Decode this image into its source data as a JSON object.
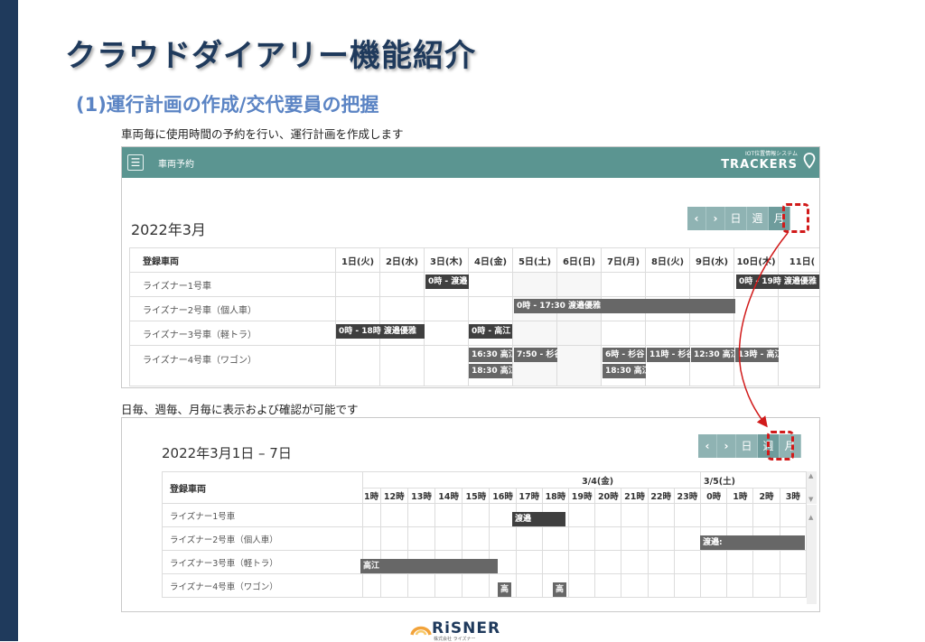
{
  "slide": {
    "title": "クラウドダイアリー機能紹介",
    "subtitle": "(1)運行計画の作成/交代要員の把握",
    "desc1": "車両毎に使用時間の予約を行い、運行計画を作成します",
    "desc2": "日毎、週毎、月毎に表示および確認が可能です",
    "logo_text": "RiSNER",
    "logo_sub": "株式会社 ライズナー"
  },
  "app": {
    "menu_icon": "hamburger-icon",
    "label": "車両予約",
    "brand_small": "IOT位置情報システム",
    "brand_name": "TRACKERS",
    "brand_icon": "map-pin-icon"
  },
  "month": {
    "title": "2022年3月",
    "buttons": {
      "prev": "‹",
      "next": "›",
      "day": "日",
      "week": "週",
      "month": "月"
    },
    "header": [
      "登録車両",
      "1日(火)",
      "2日(水)",
      "3日(木)",
      "4日(金)",
      "5日(土)",
      "6日(日)",
      "7日(月)",
      "8日(火)",
      "9日(水)",
      "10日(木)",
      "11日("
    ],
    "vehicles": [
      "ライズナー1号車",
      "ライズナー2号車（個人車）",
      "ライズナー3号車（軽トラ）",
      "ライズナー4号車（ワゴン）"
    ],
    "events": {
      "e1": "0時 - 渡邉",
      "e2": "0時 - 19時 渡邉優雅",
      "e3": "0時 - 17:30 渡邉優雅",
      "e4": "0時 - 18時 渡邉優雅",
      "e5": "0時 - 高江",
      "e6": "16:30 高江",
      "e7": "7:50 - 杉谷",
      "e8": "6時 - 杉谷",
      "e9": "11時 - 杉谷",
      "e10": "12:30 高江",
      "e11": "13時 - 高江",
      "e12": "18:30 高江",
      "e13": "18:30 高江"
    }
  },
  "week": {
    "title": "2022年3月1日 – 7日",
    "buttons": {
      "prev": "‹",
      "next": "›",
      "day": "日",
      "week": "週",
      "month": "月"
    },
    "vehicle_header": "登録車両",
    "date1": "3/4(金)",
    "date2": "3/5(土)",
    "hours": [
      "1時",
      "12時",
      "13時",
      "14時",
      "15時",
      "16時",
      "17時",
      "18時",
      "19時",
      "20時",
      "21時",
      "22時",
      "23時",
      "0時",
      "1時",
      "2時",
      "3時"
    ],
    "vehicles": [
      "ライズナー1号車",
      "ライズナー2号車（個人車）",
      "ライズナー3号車（軽トラ）",
      "ライズナー4号車（ワゴン）"
    ],
    "events": {
      "w1": "渡邉",
      "w2": "渡邉:",
      "w3": "高江",
      "w4": "高",
      "w5": "高"
    }
  },
  "colors": {
    "accent": "#5b9591",
    "title": "#1f3a5c",
    "subtitle": "#5b84c4",
    "highlight": "#d11a1a"
  }
}
